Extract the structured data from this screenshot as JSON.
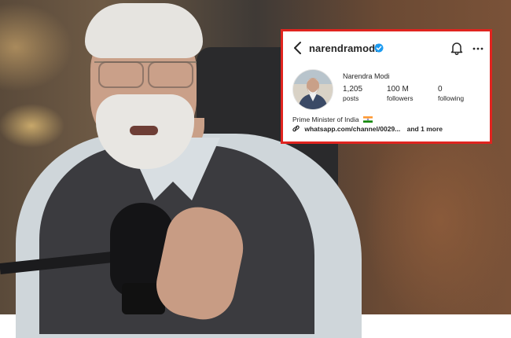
{
  "profile": {
    "username": "narendramodi",
    "full_name": "Narendra Modi",
    "stats": [
      {
        "value": "1,205",
        "label": "posts"
      },
      {
        "value": "100 M",
        "label": "followers"
      },
      {
        "value": "0",
        "label": "following"
      }
    ],
    "bio": "Prime Minister of India",
    "link_text": "whatsapp.com/channel/0029...",
    "more_links": "and 1 more"
  },
  "colors": {
    "highlight_border": "#e0241f",
    "verified_badge": "#1d9bf0"
  },
  "icons": [
    "back-arrow",
    "verified-badge",
    "bell",
    "more-options",
    "link",
    "india-flag"
  ]
}
